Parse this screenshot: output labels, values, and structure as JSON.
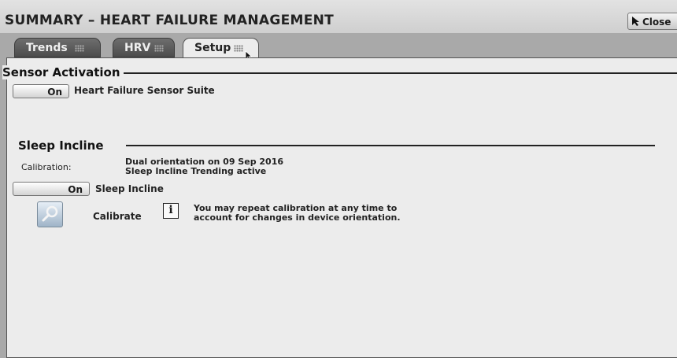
{
  "window": {
    "title": "SUMMARY – HEART FAILURE MANAGEMENT",
    "close_label": "Close"
  },
  "tabs": [
    {
      "label": "Trends",
      "active": false
    },
    {
      "label": "HRV",
      "active": false
    },
    {
      "label": "Setup",
      "active": true
    }
  ],
  "sensor_activation": {
    "heading": "Sensor Activation",
    "toggle_label": "On",
    "item_label": "Heart Failure Sensor Suite"
  },
  "sleep_incline": {
    "heading": "Sleep Incline",
    "calibration_label": "Calibration:",
    "calibration_line1": "Dual orientation on 09 Sep 2016",
    "calibration_line2": "Sleep Incline Trending active",
    "toggle_label": "On",
    "toggle_item_label": "Sleep Incline",
    "calibrate_label": "Calibrate",
    "info_line1": "You may repeat calibration at any time to",
    "info_line2": "account for changes in device orientation."
  },
  "icons": {
    "close": "arrow-cursor-icon",
    "calibrate": "magnifier-icon",
    "info": "info-icon"
  },
  "colors": {
    "tab_inactive": "#5a5a5a",
    "panel_bg": "#ececec",
    "outer_bg": "#a9a9a9"
  }
}
